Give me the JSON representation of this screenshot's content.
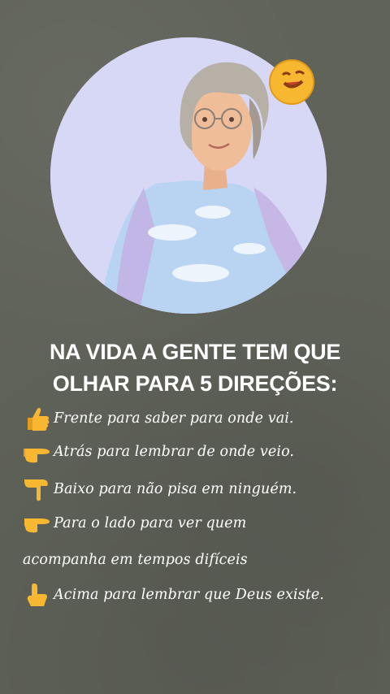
{
  "post": {
    "heading_line1": "NA VIDA A GENTE TEM QUE",
    "heading_line2": "OLHAR PARA 5 DIREÇÕES:",
    "items": [
      {
        "icon": "thumbs-up-icon",
        "text": "Frente para saber para onde vai."
      },
      {
        "icon": "pointing-right-hand-icon",
        "text": "Atrás para lembrar de onde veio."
      },
      {
        "icon": "pointing-down-hand-icon",
        "text": "Baixo para não pisa em ninguém."
      },
      {
        "icon": "pointing-right-hand-icon",
        "text": "Para o lado para ver quem"
      },
      {
        "icon": "",
        "text": "acompanha em tempos difíceis"
      },
      {
        "icon": "pointing-up-hand-icon",
        "text": "Acima para lembrar que Deus existe."
      }
    ]
  },
  "colors": {
    "background": "#5f6258",
    "avatar_background": "#d6d8f6",
    "text": "#ffffff",
    "emoji_yellow": "#f7b731"
  }
}
